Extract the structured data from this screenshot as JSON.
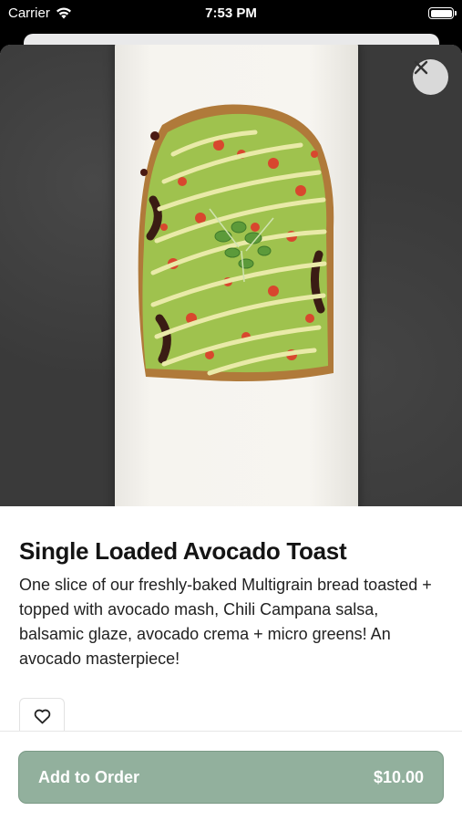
{
  "status_bar": {
    "carrier": "Carrier",
    "time": "7:53 PM"
  },
  "item": {
    "title": "Single Loaded Avocado Toast",
    "description": "One slice of our freshly-baked Multigrain bread toasted + topped with avocado mash, Chili Campana salsa, balsamic glaze, avocado crema + micro greens! An avocado masterpiece!",
    "image_icon": "avocado-toast-photo"
  },
  "actions": {
    "close_icon": "close-icon",
    "favorite_icon": "heart-icon",
    "add_to_order_label": "Add to Order",
    "price": "$10.00"
  },
  "colors": {
    "accent": "#92b09d",
    "text": "#141414"
  }
}
